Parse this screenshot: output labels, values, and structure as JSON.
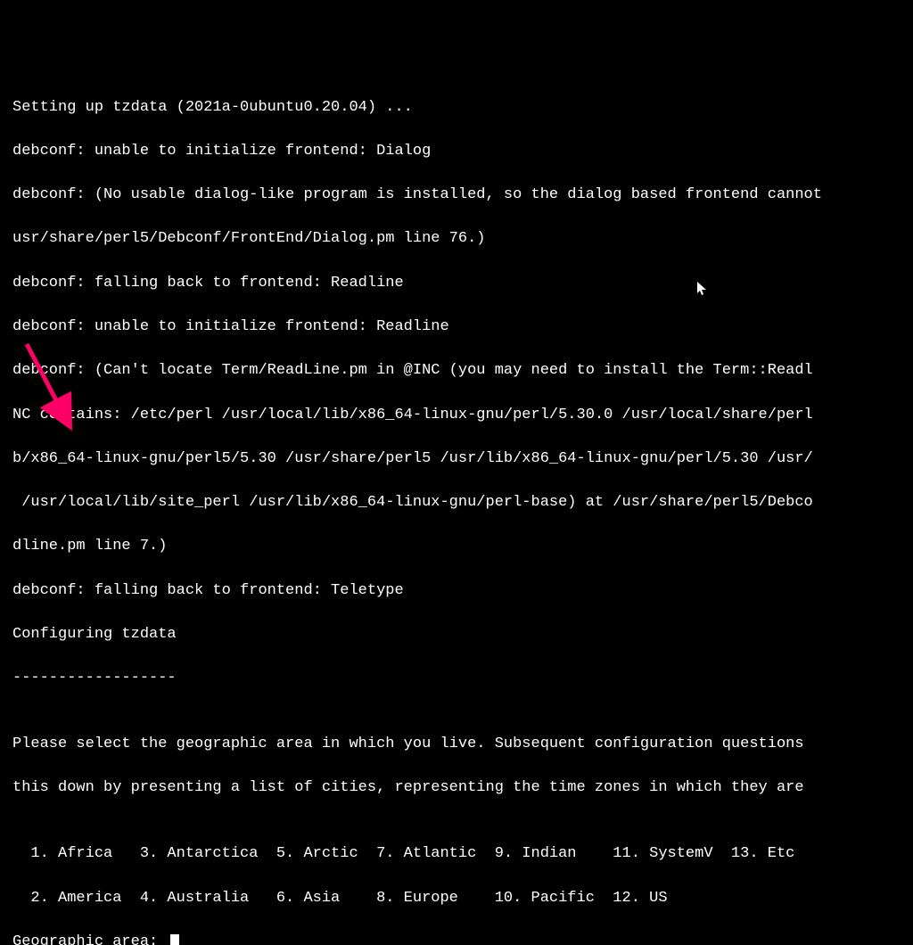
{
  "lines": {
    "l1": "Setting up tzdata (2021a-0ubuntu0.20.04) ...",
    "l2": "debconf: unable to initialize frontend: Dialog",
    "l3": "debconf: (No usable dialog-like program is installed, so the dialog based frontend cannot",
    "l4": "usr/share/perl5/Debconf/FrontEnd/Dialog.pm line 76.)",
    "l5": "debconf: falling back to frontend: Readline",
    "l6": "debconf: unable to initialize frontend: Readline",
    "l7": "debconf: (Can't locate Term/ReadLine.pm in @INC (you may need to install the Term::Readl",
    "l8": "NC contains: /etc/perl /usr/local/lib/x86_64-linux-gnu/perl/5.30.0 /usr/local/share/perl",
    "l9": "b/x86_64-linux-gnu/perl5/5.30 /usr/share/perl5 /usr/lib/x86_64-linux-gnu/perl/5.30 /usr/",
    "l10": " /usr/local/lib/site_perl /usr/lib/x86_64-linux-gnu/perl-base) at /usr/share/perl5/Debco",
    "l11": "dline.pm line 7.)",
    "l12": "debconf: falling back to frontend: Teletype",
    "l13": "Configuring tzdata",
    "l14": "------------------",
    "blank1": "",
    "l15": "Please select the geographic area in which you live. Subsequent configuration questions ",
    "l16": "this down by presenting a list of cities, representing the time zones in which they are ",
    "blank2": ""
  },
  "options": {
    "row1": "  1. Africa   3. Antarctica  5. Arctic  7. Atlantic  9. Indian    11. SystemV  13. Etc",
    "row2": "  2. America  4. Australia   6. Asia    8. Europe    10. Pacific  12. US"
  },
  "prompt": {
    "label": "Geographic area: "
  },
  "annotation": {
    "arrow_color": "#ff0066"
  }
}
